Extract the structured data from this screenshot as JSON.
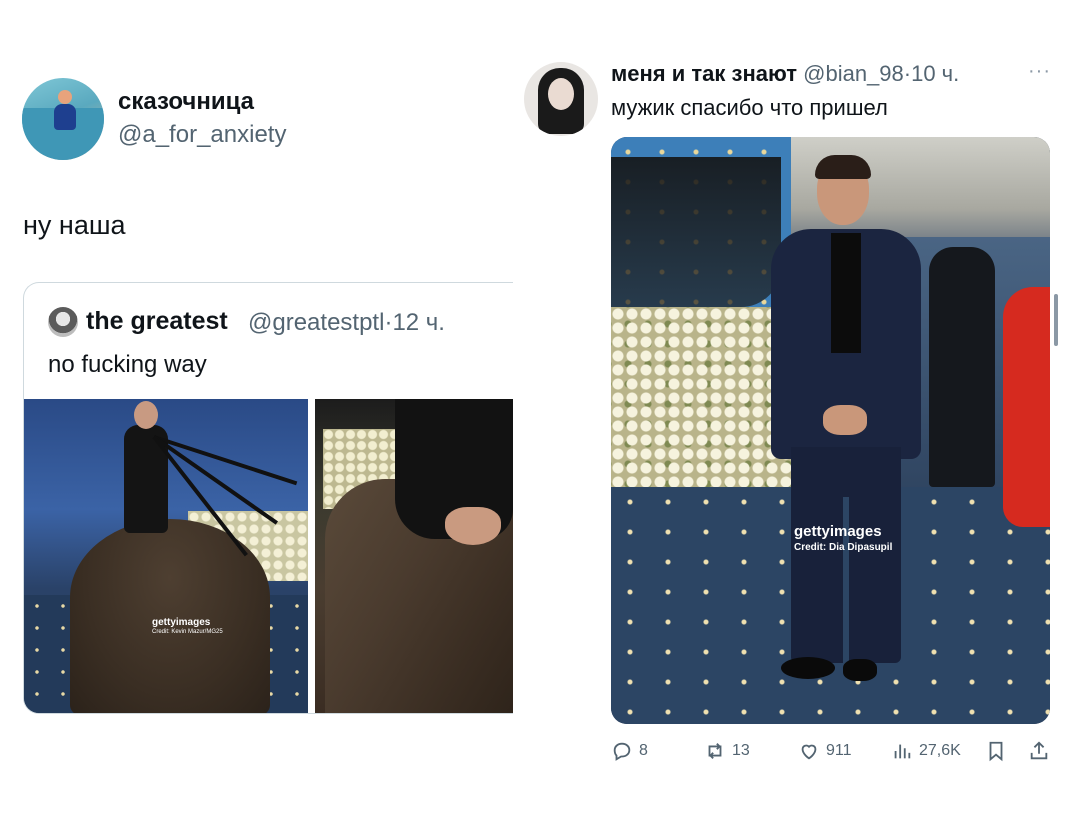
{
  "left_tweet": {
    "author_name": "сказочница",
    "author_handle": "@a_for_anxiety",
    "text": "ну наша",
    "quote": {
      "author_name": "the greatest",
      "author_handle": "@greatestptl",
      "separator": "·",
      "time": "12 ч.",
      "text": "no fucking way",
      "watermark_logo": "gettyimages",
      "watermark_credit": "Credit: Kevin Mazur/MG25"
    }
  },
  "right_tweet": {
    "author_name": "меня и так знают",
    "author_handle": "@bian_98",
    "separator": "·",
    "time": "10 ч.",
    "more": "···",
    "text": "мужик спасибо что пришел",
    "watermark_logo": "gettyimages",
    "watermark_credit": "Credit: Dia Dipasupil",
    "actions": {
      "replies": "8",
      "retweets": "13",
      "likes": "911",
      "views": "27,6K"
    }
  },
  "icons": {
    "reply": "reply-icon",
    "retweet": "retweet-icon",
    "like": "heart-icon",
    "views": "views-icon",
    "bookmark": "bookmark-icon",
    "share": "share-icon",
    "more": "more-icon"
  },
  "colors": {
    "text_primary": "#0f1419",
    "text_secondary": "#536471",
    "border": "#cfd9de"
  }
}
